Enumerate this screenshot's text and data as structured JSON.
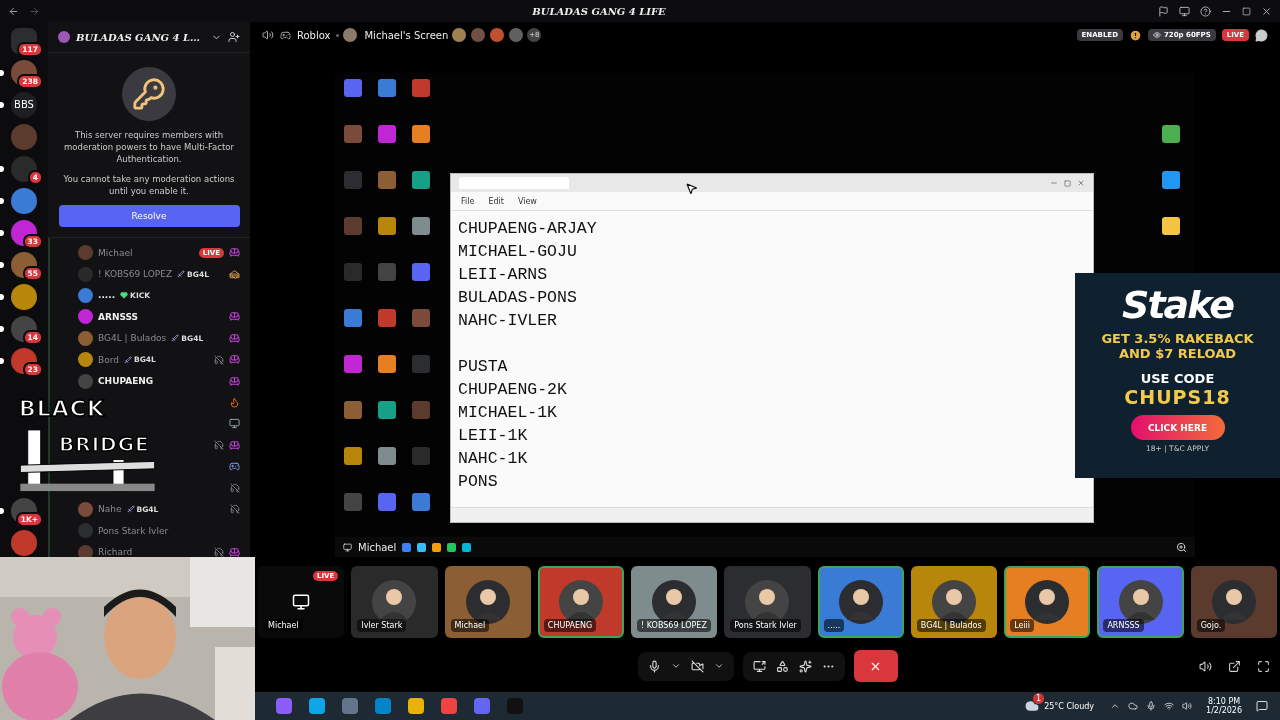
{
  "title_bar": {
    "title": "BULADAS GANG 4 LIFE"
  },
  "rail_top": [
    {
      "kind": "app",
      "badge": "117",
      "unread": false
    },
    {
      "kind": "server",
      "badge": "238",
      "unread": true
    },
    {
      "kind": "text",
      "label": "BBS",
      "unread": true
    },
    {
      "kind": "server",
      "unread": false
    },
    {
      "kind": "server",
      "badge": "4",
      "unread": true
    },
    {
      "kind": "server",
      "unread": true
    },
    {
      "kind": "server",
      "badge": "33",
      "unread": true
    },
    {
      "kind": "server",
      "badge": "55",
      "unread": true
    },
    {
      "kind": "server",
      "unread": true
    },
    {
      "kind": "server",
      "badge": "14",
      "unread": true
    },
    {
      "kind": "server",
      "badge": "23",
      "unread": true
    }
  ],
  "rail_bottom": [
    {
      "kind": "server",
      "badge": "1K+",
      "unread": true
    },
    {
      "kind": "server",
      "unread": false
    }
  ],
  "sidebar": {
    "server_name": "BULADAS GANG 4 L…",
    "notice": {
      "text": "This server requires members with moderation powers to have Multi-Factor Authentication.",
      "subtext": "You cannot take any moderation actions until you enable it.",
      "button": "Resolve"
    }
  },
  "members": [
    {
      "name": "Michael",
      "dimmed": true,
      "live": "LIVE",
      "activity": {
        "kind": "couch"
      },
      "deafened": false
    },
    {
      "name": "! KOBS69 LOPEZ",
      "dimmed": true,
      "tag": {
        "kind": "role",
        "label": "BG4L"
      },
      "activity": {
        "kind": "burger"
      },
      "deafened": false
    },
    {
      "name": ".....",
      "dimmed": false,
      "tag": {
        "kind": "kick",
        "label": "KICK"
      },
      "deafened": false
    },
    {
      "name": "ARNSSS",
      "dimmed": false,
      "activity": {
        "kind": "couch"
      },
      "deafened": false
    },
    {
      "name": "BG4L | Bulados",
      "dimmed": true,
      "tag": {
        "kind": "role",
        "label": "BG4L"
      },
      "activity": {
        "kind": "couch"
      },
      "deafened": false
    },
    {
      "name": "Bord",
      "dimmed": true,
      "tag": {
        "kind": "role",
        "label": "BG4L"
      },
      "activity": {
        "kind": "couch"
      },
      "deafened": true
    },
    {
      "name": "CHUPAENG",
      "dimmed": false,
      "activity": {
        "kind": "couch"
      },
      "deafened": false
    },
    {
      "activity": {
        "kind": "fire"
      },
      "deafened": false
    },
    {
      "activity": {
        "kind": "screen"
      },
      "deafened": false
    },
    {
      "activity": {
        "kind": "couch"
      },
      "deafened": true
    },
    {
      "activity": {
        "kind": "controller"
      },
      "deafened": false
    },
    {
      "deafened": true
    },
    {
      "name": "Nahe",
      "dimmed": true,
      "tag": {
        "kind": "role",
        "label": "BG4L"
      },
      "deafened": true
    },
    {
      "name": "Pons Stark Ivler",
      "dimmed": true,
      "deafened": false
    },
    {
      "name": "Richard",
      "dimmed": true,
      "activity": {
        "kind": "couch"
      },
      "deafened": true
    }
  ],
  "overlay_logo": {
    "line1": "BLACK",
    "line2": "BRIDGE"
  },
  "stage_bar": {
    "activity": "Roblox",
    "stream_name": "Michael's Screen",
    "viewer_extra": "+8",
    "status": "ENABLED",
    "quality": "720p 60FPS",
    "live": "LIVE"
  },
  "notepad": {
    "menu": [
      "File",
      "Edit",
      "View"
    ],
    "blocks": [
      [
        "CHUPAENG-ARJAY",
        "MICHAEL-GOJU",
        "LEII-ARNS",
        "BULADAS-PONS",
        "NAHC-IVLER"
      ],
      [
        "PUSTA",
        "CHUPAENG-2K",
        "MICHAEL-1K",
        "LEII-1K",
        "NAHC-1K",
        "PONS"
      ]
    ]
  },
  "desktop_taskbar": {
    "label": "Michael"
  },
  "ad": {
    "brand": "Stake",
    "offer": "GET 3.5% RAKEBACK AND $7 RELOAD",
    "code_label": "USE CODE",
    "code": "CHUPS18",
    "button": "CLICK HERE",
    "terms": "18+ | T&C APPLY"
  },
  "tiles": [
    {
      "kind": "screen",
      "name": "Michael",
      "live": "LIVE",
      "speaking": false
    },
    {
      "kind": "avatar",
      "name": "Ivler Stark",
      "speaking": false
    },
    {
      "kind": "avatar",
      "name": "Michael",
      "speaking": false
    },
    {
      "kind": "avatar",
      "name": "CHUPAENG",
      "speaking": true
    },
    {
      "kind": "avatar",
      "name": "! KOBS69 LOPEZ",
      "speaking": false
    },
    {
      "kind": "avatar",
      "name": "Pons Stark Ivler",
      "speaking": false
    },
    {
      "kind": "avatar",
      "name": ".....",
      "speaking": true
    },
    {
      "kind": "avatar",
      "name": "BG4L | Bulados",
      "speaking": false
    },
    {
      "kind": "avatar",
      "name": "Leiii",
      "speaking": true
    },
    {
      "kind": "avatar",
      "name": "ARNSSS",
      "speaking": true
    },
    {
      "kind": "avatar",
      "name": "Gojo.",
      "speaking": false
    }
  ],
  "taskbar": {
    "weather_badge": "1",
    "weather": "25°C Cloudy",
    "time": "8:10 PM",
    "date": "1/2/2026"
  }
}
